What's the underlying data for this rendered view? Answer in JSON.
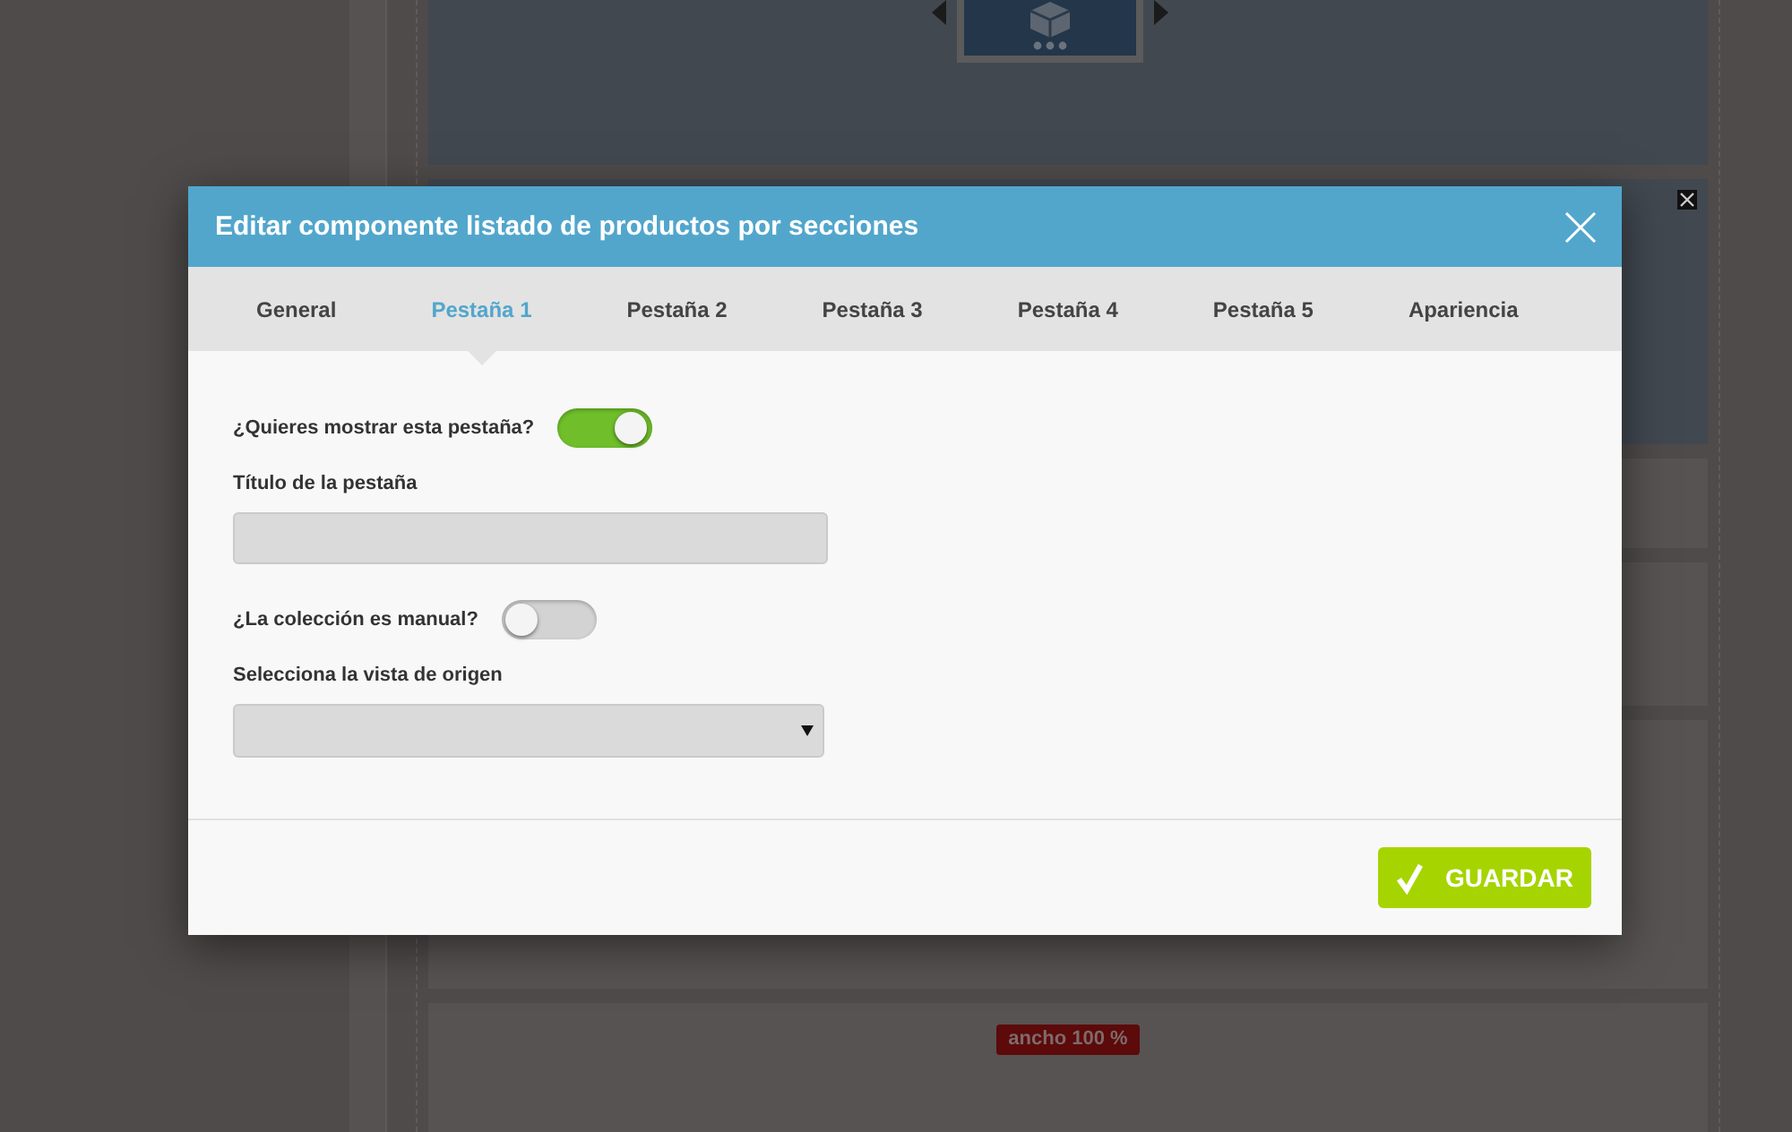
{
  "dialog": {
    "title": "Editar componente listado de productos por secciones",
    "tabs": [
      {
        "label": "General",
        "selected": false
      },
      {
        "label": "Pestaña 1",
        "selected": true
      },
      {
        "label": "Pestaña 2",
        "selected": false
      },
      {
        "label": "Pestaña 3",
        "selected": false
      },
      {
        "label": "Pestaña 4",
        "selected": false
      },
      {
        "label": "Pestaña 5",
        "selected": false
      },
      {
        "label": "Apariencia",
        "selected": false
      }
    ],
    "fields": [
      {
        "kind": "toggle",
        "label": "¿Quieres mostrar esta pestaña?",
        "on": true
      },
      {
        "kind": "text",
        "label": "Título de la pestaña"
      },
      {
        "kind": "toggle",
        "label": "¿La colección es manual?",
        "on": false
      },
      {
        "kind": "select",
        "label": "Selecciona la vista de origen"
      }
    ],
    "save_button": "GUARDAR"
  },
  "background": {
    "badge": "ancho 100 %"
  }
}
